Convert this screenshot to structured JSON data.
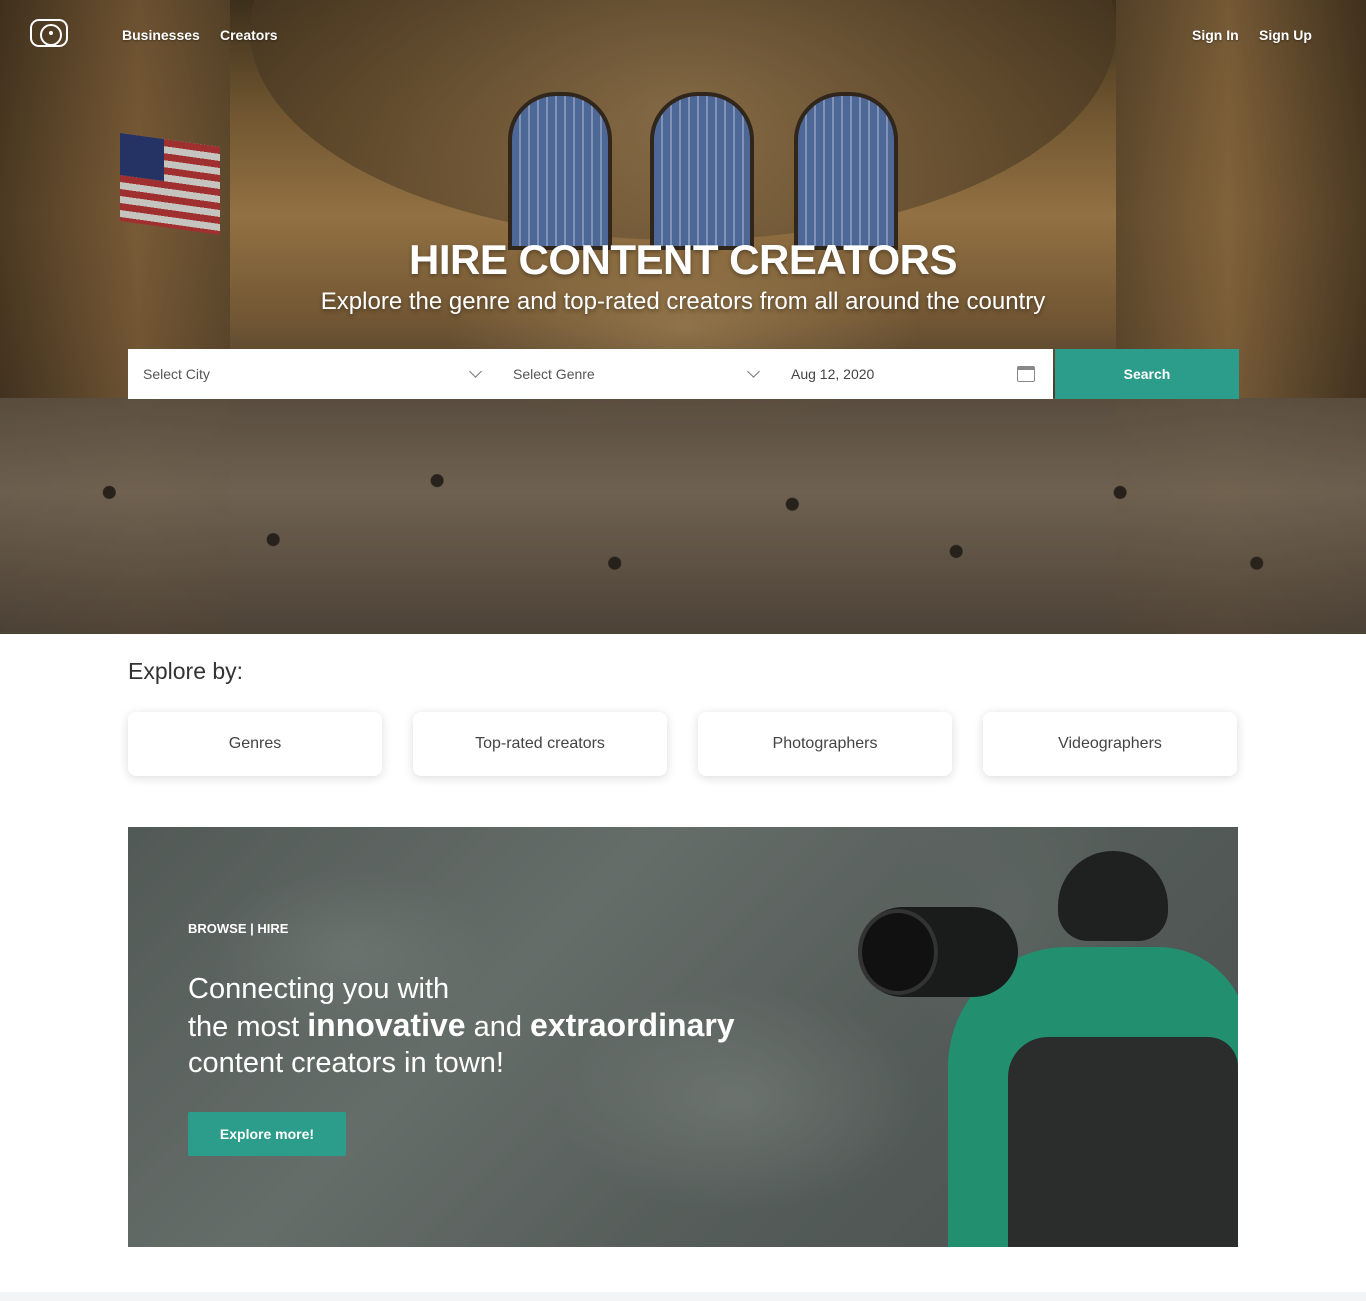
{
  "nav": {
    "links": [
      "Businesses",
      "Creators"
    ],
    "sign_in": "Sign In",
    "sign_up": "Sign Up"
  },
  "hero": {
    "title": "HIRE CONTENT CREATORS",
    "subtitle": "Explore the genre and top-rated creators from all around the country"
  },
  "search": {
    "city_placeholder": "Select City",
    "genre_placeholder": "Select Genre",
    "date_value": "Aug 12, 2020",
    "button_label": "Search"
  },
  "explore": {
    "heading": "Explore by:",
    "cards": [
      "Genres",
      "Top-rated creators",
      "Photographers",
      "Videographers"
    ]
  },
  "banner": {
    "kicker": "BROWSE | HIRE",
    "line1": "Connecting you with",
    "line2_pre": "the most ",
    "line2_bold1": "innovative",
    "line2_mid": " and ",
    "line2_bold2": "extraordinary",
    "line3": "content creators in town!",
    "button_label": "Explore more!"
  },
  "colors": {
    "accent": "#2b9d8a"
  }
}
